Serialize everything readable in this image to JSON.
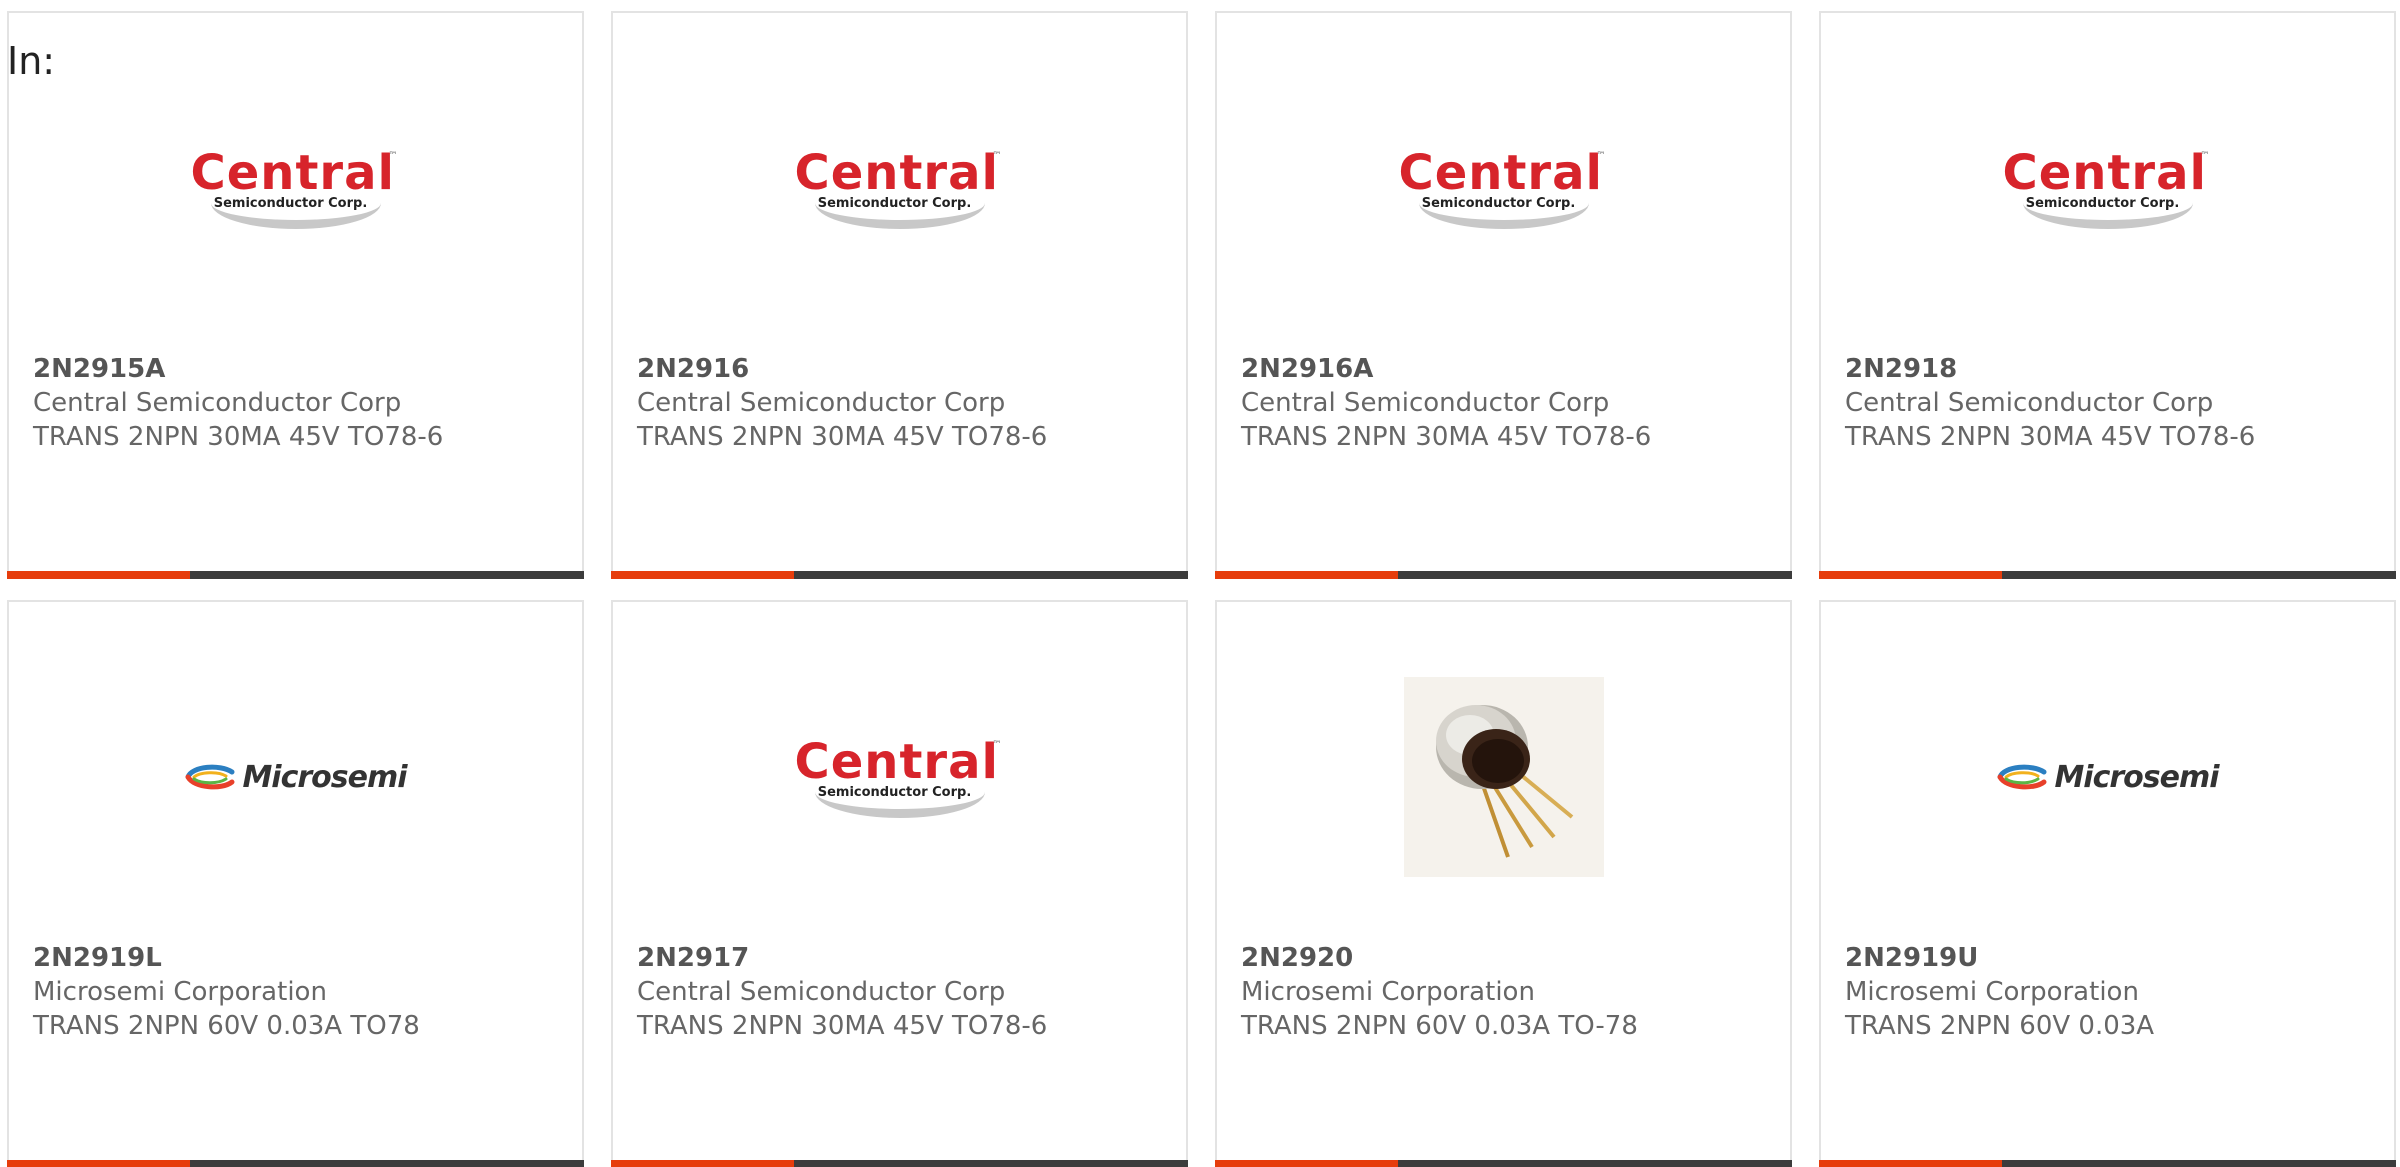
{
  "header": {
    "in_label": "In:"
  },
  "colors": {
    "accent": "#e63d0c",
    "bar": "#3c3c3c",
    "card_border": "#e3e3e3",
    "text": "#666666",
    "central_red": "#d7242b"
  },
  "logos": {
    "central": {
      "word": "Central",
      "tm": "™",
      "sub": "Semiconductor Corp."
    },
    "microsemi": {
      "word": "Microsemi"
    }
  },
  "products": [
    {
      "part_number": "2N2915A",
      "manufacturer": "Central Semiconductor Corp",
      "description": "TRANS 2NPN 30MA 45V TO78-6",
      "image": "central-logo"
    },
    {
      "part_number": "2N2916",
      "manufacturer": "Central Semiconductor Corp",
      "description": "TRANS 2NPN 30MA 45V TO78-6",
      "image": "central-logo"
    },
    {
      "part_number": "2N2916A",
      "manufacturer": "Central Semiconductor Corp",
      "description": "TRANS 2NPN 30MA 45V TO78-6",
      "image": "central-logo"
    },
    {
      "part_number": "2N2918",
      "manufacturer": "Central Semiconductor Corp",
      "description": "TRANS 2NPN 30MA 45V TO78-6",
      "image": "central-logo"
    },
    {
      "part_number": "2N2919L",
      "manufacturer": "Microsemi Corporation",
      "description": "TRANS 2NPN 60V 0.03A TO78",
      "image": "microsemi-logo"
    },
    {
      "part_number": "2N2917",
      "manufacturer": "Central Semiconductor Corp",
      "description": "TRANS 2NPN 30MA 45V TO78-6",
      "image": "central-logo"
    },
    {
      "part_number": "2N2920",
      "manufacturer": "Microsemi Corporation",
      "description": "TRANS 2NPN 60V 0.03A TO-78",
      "image": "transistor-photo"
    },
    {
      "part_number": "2N2919U",
      "manufacturer": "Microsemi Corporation",
      "description": "TRANS 2NPN 60V 0.03A",
      "image": "microsemi-logo"
    }
  ]
}
